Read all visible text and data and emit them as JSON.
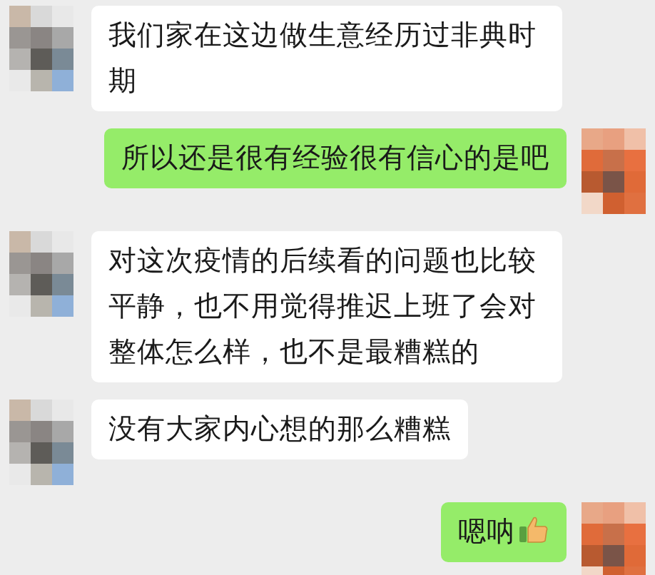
{
  "messages": [
    {
      "kind": "incoming",
      "text": "我们家在这边做生意经历过非典时期"
    },
    {
      "kind": "outgoing",
      "text": "所以还是很有经验很有信心的是吧"
    },
    {
      "kind": "incoming",
      "text": "对这次疫情的后续看的问题也比较平静，也不用觉得推迟上班了会对整体怎么样，也不是最糟糕的"
    },
    {
      "kind": "incoming",
      "text": "没有大家内心想的那么糟糕"
    },
    {
      "kind": "outgoing",
      "text": "嗯呐",
      "thumbs_up": true
    }
  ]
}
